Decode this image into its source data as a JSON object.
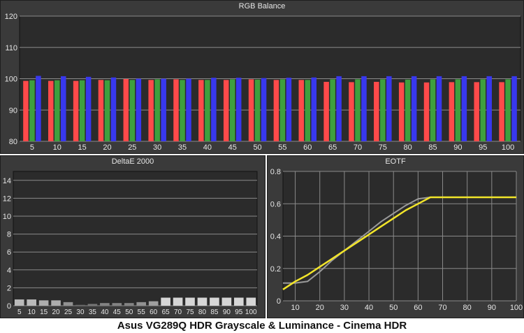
{
  "caption": "Asus VG289Q HDR Grayscale & Luminance - Cinema HDR",
  "colors": {
    "panel_bg": "#3a3a3a",
    "plot_bg": "#2b2b2b",
    "grid": "#8a8a8a",
    "text": "#e6e6e6",
    "red": "#ff4a4a",
    "green": "#3ea03e",
    "blue": "#3838ee",
    "target": "#9a9a9a",
    "measured": "#f2e52a"
  },
  "chart_data": [
    {
      "type": "bar",
      "title": "RGB Balance",
      "categories": [
        "5",
        "10",
        "15",
        "20",
        "25",
        "30",
        "35",
        "40",
        "45",
        "50",
        "55",
        "60",
        "65",
        "70",
        "75",
        "80",
        "85",
        "90",
        "95",
        "100"
      ],
      "series": [
        {
          "name": "Red",
          "values": [
            99.3,
            99.3,
            99.3,
            99.6,
            99.9,
            99.6,
            99.8,
            99.6,
            99.6,
            99.8,
            99.6,
            99.6,
            99.0,
            98.9,
            99.0,
            98.8,
            98.8,
            98.9,
            98.9,
            98.9
          ]
        },
        {
          "name": "Green",
          "values": [
            99.5,
            99.5,
            99.5,
            99.5,
            99.6,
            99.8,
            99.6,
            99.6,
            99.8,
            99.7,
            99.8,
            99.6,
            99.8,
            99.8,
            99.8,
            99.7,
            99.8,
            99.8,
            99.8,
            99.8
          ]
        },
        {
          "name": "Blue",
          "values": [
            100.9,
            100.8,
            100.6,
            100.4,
            100.0,
            100.0,
            100.0,
            100.3,
            100.3,
            100.2,
            100.3,
            100.4,
            100.8,
            100.8,
            100.8,
            100.8,
            100.8,
            100.8,
            100.8,
            100.8
          ]
        }
      ],
      "ylim": [
        80,
        120
      ],
      "yticks": [
        "80",
        "90",
        "100",
        "110",
        "120"
      ],
      "grid": true
    },
    {
      "type": "bar",
      "title": "DeltaE 2000",
      "categories": [
        "5",
        "10",
        "15",
        "20",
        "25",
        "30",
        "35",
        "40",
        "45",
        "50",
        "55",
        "60",
        "65",
        "70",
        "75",
        "80",
        "85",
        "90",
        "95",
        "100"
      ],
      "values": [
        0.7,
        0.7,
        0.6,
        0.6,
        0.4,
        0.1,
        0.2,
        0.3,
        0.3,
        0.3,
        0.4,
        0.5,
        0.9,
        0.9,
        0.9,
        0.9,
        0.9,
        0.9,
        0.9,
        0.9
      ],
      "ylim": [
        0,
        15
      ],
      "yticks": [
        "0",
        "2",
        "4",
        "6",
        "8",
        "10",
        "12",
        "14"
      ],
      "grid": true
    },
    {
      "type": "line",
      "title": "EOTF",
      "xlim": [
        5,
        100
      ],
      "ylim": [
        0,
        0.8
      ],
      "xticks": [
        "10",
        "20",
        "30",
        "40",
        "50",
        "60",
        "70",
        "80",
        "90",
        "100"
      ],
      "yticks": [
        "0",
        "0.2",
        "0.4",
        "0.6",
        "0.8"
      ],
      "grid": true,
      "series": [
        {
          "x": [
            5,
            10,
            15,
            20,
            25,
            30,
            35,
            40,
            45,
            50,
            55,
            60,
            65,
            70,
            75,
            80,
            85,
            90,
            95,
            100
          ],
          "y": [
            0.11,
            0.11,
            0.12,
            0.18,
            0.25,
            0.31,
            0.37,
            0.43,
            0.49,
            0.54,
            0.59,
            0.63,
            0.64,
            0.64,
            0.64,
            0.64,
            0.64,
            0.64,
            0.64,
            0.64
          ]
        },
        {
          "x": [
            5,
            10,
            15,
            20,
            25,
            30,
            35,
            40,
            45,
            50,
            55,
            60,
            65,
            70,
            75,
            80,
            85,
            90,
            95,
            100
          ],
          "y": [
            0.07,
            0.12,
            0.16,
            0.21,
            0.26,
            0.31,
            0.36,
            0.41,
            0.46,
            0.51,
            0.56,
            0.6,
            0.64,
            0.64,
            0.64,
            0.64,
            0.64,
            0.64,
            0.64,
            0.64
          ]
        }
      ]
    }
  ]
}
